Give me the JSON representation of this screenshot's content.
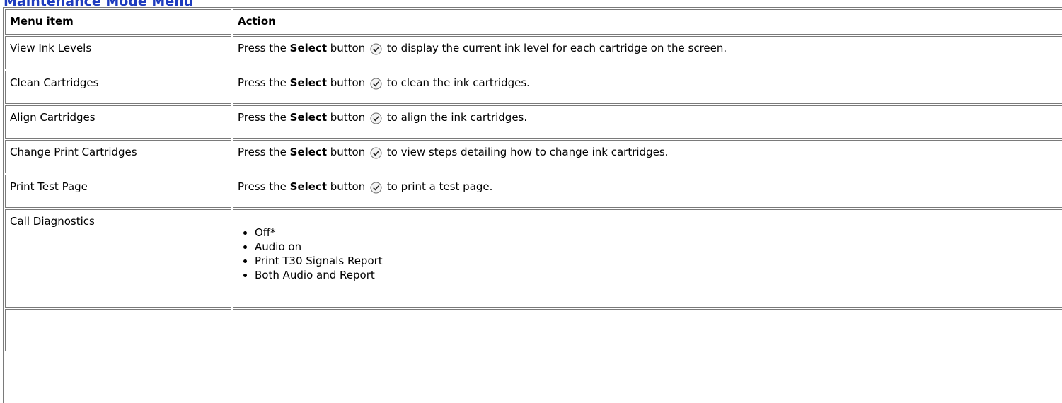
{
  "page": {
    "heading": "Maintenance Mode Menu"
  },
  "table": {
    "headers": [
      "Menu item",
      "Action"
    ],
    "rows": [
      {
        "item": "View Ink Levels",
        "pre": "Press the ",
        "bold": "Select",
        "mid": " button",
        "post": " to display the current ink level for each cartridge on the screen."
      },
      {
        "item": "Clean Cartridges",
        "pre": "Press the ",
        "bold": "Select",
        "mid": " button",
        "post": " to clean the ink cartridges."
      },
      {
        "item": "Align Cartridges",
        "pre": "Press the ",
        "bold": "Select",
        "mid": " button",
        "post": " to align the ink cartridges."
      },
      {
        "item": "Change Print Cartridges",
        "pre": "Press the ",
        "bold": "Select",
        "mid": " button",
        "post": " to view steps detailing how to change ink cartridges."
      },
      {
        "item": "Print Test Page",
        "pre": "Press the ",
        "bold": "Select",
        "mid": " button",
        "post": " to print a test page."
      }
    ],
    "call_diagnostics": {
      "item": "Call Diagnostics",
      "options": [
        "Off*",
        "Audio on",
        "Print T30 Signals Report",
        "Both Audio and Report"
      ]
    }
  },
  "icons": {
    "select": "select-button-checkmark-icon"
  }
}
